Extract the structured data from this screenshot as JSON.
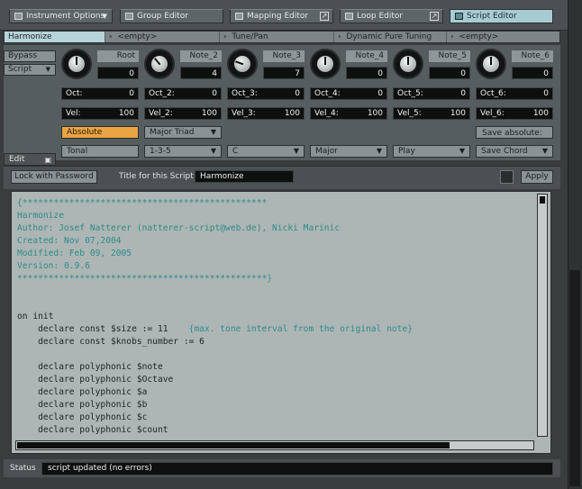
{
  "toolbar": {
    "buttons": [
      {
        "label": "Instrument Options",
        "has_dropdown": true
      },
      {
        "label": "Group Editor"
      },
      {
        "label": "Mapping Editor"
      },
      {
        "label": "Loop Editor"
      },
      {
        "label": "Script Editor"
      }
    ],
    "active": "Script Editor"
  },
  "slots": [
    {
      "label": "Harmonize",
      "active": true
    },
    {
      "label": "<empty>"
    },
    {
      "label": "Tune/Pan"
    },
    {
      "label": "Dynamic Pure Tuning"
    },
    {
      "label": "<empty>"
    }
  ],
  "side": {
    "bypass": "Bypass",
    "script": "Script"
  },
  "knobs": [
    {
      "label": "Root",
      "value": "0",
      "oct_label": "Oct:",
      "oct": "0",
      "vel_label": "Vel:",
      "vel": "100"
    },
    {
      "label": "Note_2",
      "value": "4",
      "oct_label": "Oct_2:",
      "oct": "0",
      "vel_label": "Vel_2:",
      "vel": "100"
    },
    {
      "label": "Note_3",
      "value": "7",
      "oct_label": "Oct_3:",
      "oct": "0",
      "vel_label": "Vel_3:",
      "vel": "100"
    },
    {
      "label": "Note_4",
      "value": "0",
      "oct_label": "Oct_4:",
      "oct": "0",
      "vel_label": "Vel_4:",
      "vel": "100"
    },
    {
      "label": "Note_5",
      "value": "0",
      "oct_label": "Oct_5:",
      "oct": "0",
      "vel_label": "Vel_5:",
      "vel": "100"
    },
    {
      "label": "Note_6",
      "value": "0",
      "oct_label": "Oct_6:",
      "oct": "0",
      "vel_label": "Vel_6:",
      "vel": "100"
    }
  ],
  "row_a": {
    "absolute": "Absolute",
    "chord_type": "Major Triad",
    "save_absolute": "Save absolute:"
  },
  "row_b": {
    "tonal": "Tonal",
    "intervals": "1-3-5",
    "key": "C",
    "scale": "Major",
    "play": "Play",
    "save_chord": "Save Chord"
  },
  "edit": {
    "tab": "Edit",
    "lock_button": "Lock with Password",
    "title_label": "Title for this Script",
    "title_value": "Harmonize",
    "apply": "Apply"
  },
  "code_lines": [
    "{***********************************************",
    "Harmonize",
    "Author: Josef Natterer (natterer-script@web.de), Nicki Marinic",
    "Created: Nov 07,2004",
    "Modified: Feb 09, 2005",
    "Version: 0.9.6",
    "************************************************}",
    "",
    "",
    "on init",
    "    declare const $size := 11    {max. tone interval from the original note}",
    "    declare const $knobs_number := 6",
    "",
    "    declare polyphonic $note",
    "    declare polyphonic $Octave",
    "    declare polyphonic $a",
    "    declare polyphonic $b",
    "    declare polyphonic $c",
    "    declare polyphonic $count"
  ],
  "status": {
    "label": "Status",
    "text": "script updated (no errors)"
  },
  "colors": {
    "active_tab": "#a7cbd2",
    "absolute_orange": "#e9a444",
    "code_bg": "#adb6b4",
    "comment_teal": "#2f8b8a"
  }
}
